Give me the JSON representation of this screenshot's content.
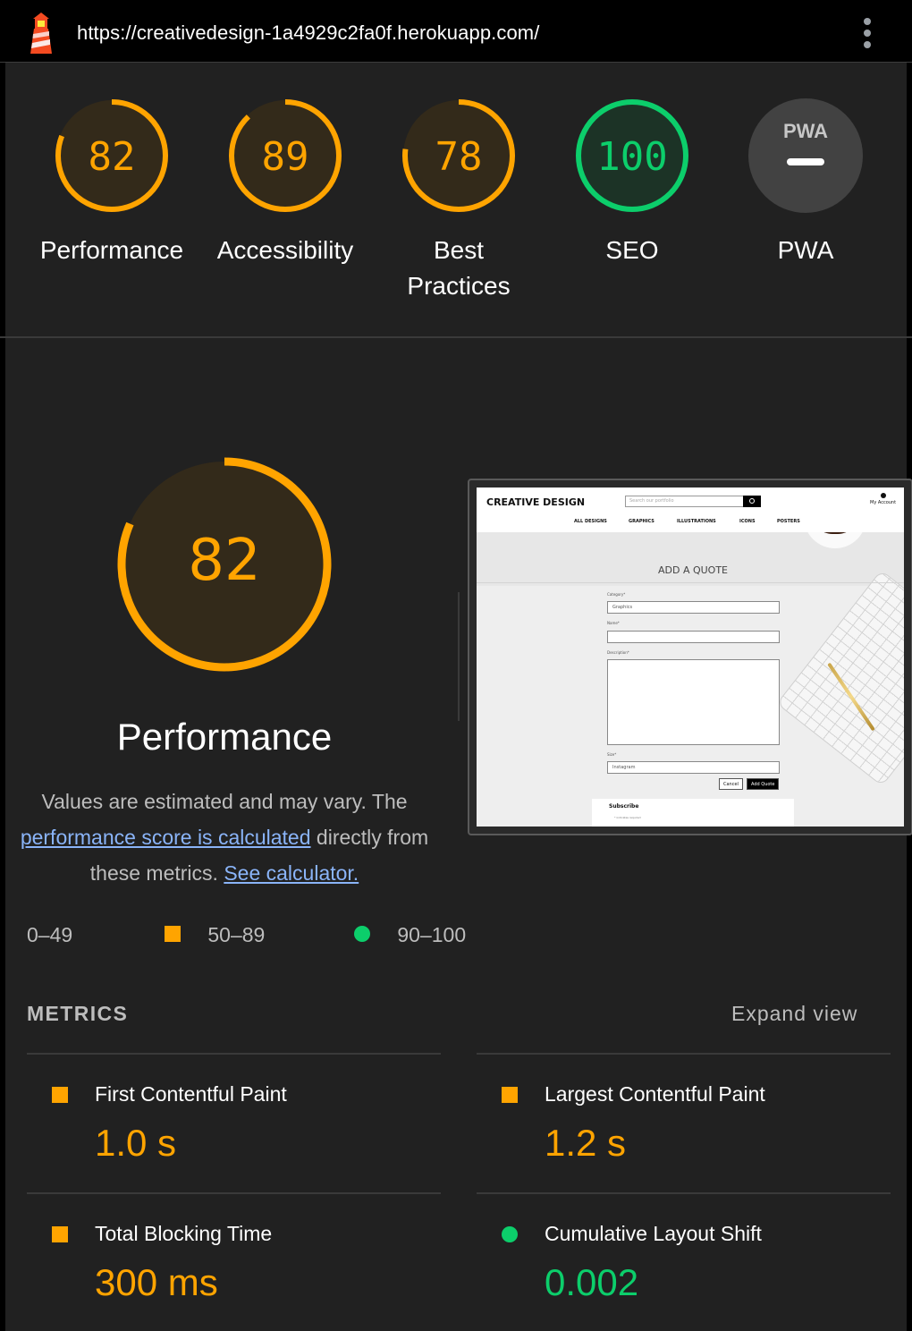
{
  "topbar": {
    "url": "https://creativedesign-1a4929c2fa0f.herokuapp.com/"
  },
  "categories": [
    {
      "label": "Performance",
      "score": "82",
      "fraction": 0.82
    },
    {
      "label": "Accessibility",
      "score": "89",
      "fraction": 0.89
    },
    {
      "label_line1": "Best",
      "label_line2": "Practices",
      "score": "78",
      "fraction": 0.78
    },
    {
      "label": "SEO",
      "score": "100",
      "fraction": 1.0
    },
    {
      "label": "PWA",
      "badge": "PWA"
    }
  ],
  "performance": {
    "score": "82",
    "fraction": 0.82,
    "title": "Performance",
    "desc_part1": "Values are estimated and may vary. The",
    "desc_link1": "performance score is calculated",
    "desc_part2": "directly from",
    "desc_part3": "these metrics.",
    "desc_link2": "See calculator."
  },
  "legend": {
    "fail": "0–49",
    "average": "50–89",
    "pass": "90–100"
  },
  "screenshot": {
    "brand": "CREATIVE DESIGN",
    "search_placeholder": "Search our portfolio",
    "account": "My Account",
    "nav": [
      "ALL DESIGNS",
      "GRAPHICS",
      "ILLUSTRATIONS",
      "ICONS",
      "POSTERS"
    ],
    "heading": "ADD A QUOTE",
    "category_label": "Category*",
    "category_value": "Graphics",
    "name_label": "Name*",
    "description_label": "Description*",
    "size_label": "Size*",
    "size_value": "Instagram",
    "cancel": "Cancel",
    "add": "Add Quote",
    "subscribe": "Subscribe",
    "subscribe_note": "* indicates required"
  },
  "metrics": {
    "heading": "METRICS",
    "expand": "Expand view",
    "items": [
      {
        "name": "First Contentful Paint",
        "value": "1.0 s",
        "status": "average"
      },
      {
        "name": "Largest Contentful Paint",
        "value": "1.2 s",
        "status": "average"
      },
      {
        "name": "Total Blocking Time",
        "value": "300 ms",
        "status": "average"
      },
      {
        "name": "Cumulative Layout Shift",
        "value": "0.002",
        "status": "pass"
      }
    ]
  },
  "colors": {
    "average": "#ffa400",
    "pass": "#0cce6b",
    "average_bg": "#332a1a",
    "pass_bg": "#1c3326",
    "pwa_bg": "#424242",
    "link": "#8ab4f8"
  }
}
